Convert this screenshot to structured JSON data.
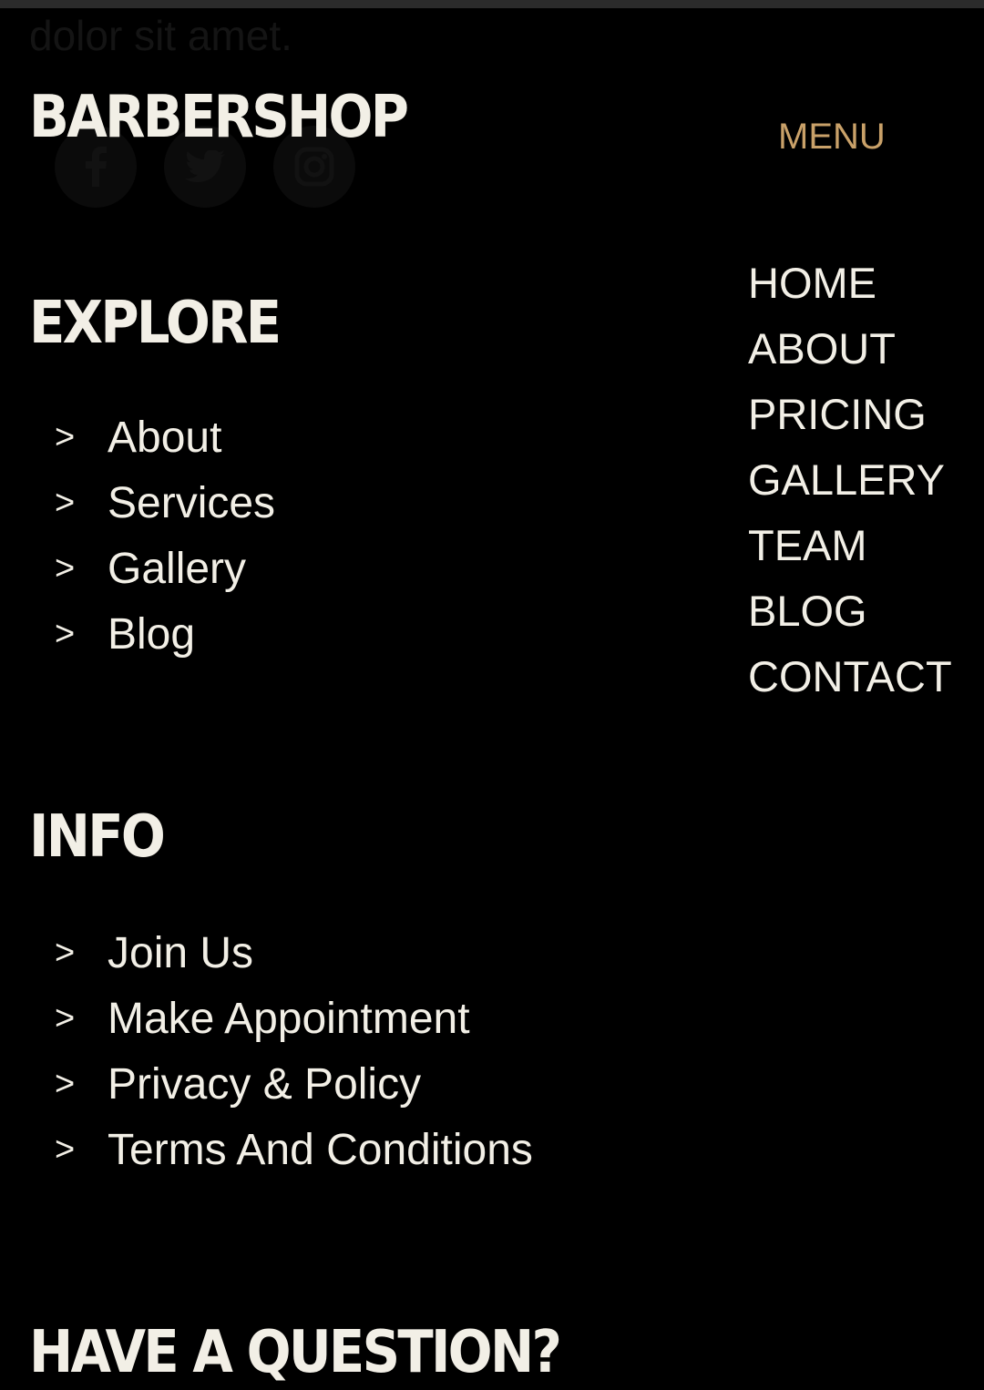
{
  "ghost_text": "dolor sit amet.",
  "social": [
    {
      "icon": "facebook-icon"
    },
    {
      "icon": "twitter-icon"
    },
    {
      "icon": "instagram-icon"
    }
  ],
  "header": {
    "brand": "BARBERSHOP",
    "menu_label": "MENU",
    "menu_color": "#c9a169"
  },
  "menu": {
    "items": [
      "HOME",
      "ABOUT",
      "PRICING",
      "GALLERY",
      "TEAM",
      "BLOG",
      "CONTACT"
    ]
  },
  "explore": {
    "title": "EXPLORE",
    "links": [
      {
        "chevron": ">",
        "label": "About"
      },
      {
        "chevron": ">",
        "label": "Services"
      },
      {
        "chevron": ">",
        "label": "Gallery"
      },
      {
        "chevron": ">",
        "label": "Blog"
      }
    ]
  },
  "info": {
    "title": "INFO",
    "links": [
      {
        "chevron": ">",
        "label": "Join Us"
      },
      {
        "chevron": ">",
        "label": "Make Appointment"
      },
      {
        "chevron": ">",
        "label": "Privacy & Policy"
      },
      {
        "chevron": ">",
        "label": "Terms And Conditions"
      }
    ]
  },
  "question": {
    "title": "HAVE A QUESTION?"
  },
  "colors": {
    "background": "#000000",
    "text": "#f2efe6",
    "accent": "#c9a169"
  }
}
